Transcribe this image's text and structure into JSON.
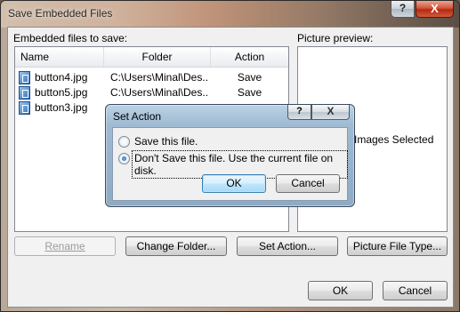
{
  "window": {
    "title": "Save Embedded Files",
    "close_glyph": "X",
    "help_glyph": "?"
  },
  "list": {
    "label": "Embedded files to save:",
    "columns": [
      "Name",
      "Folder",
      "Action"
    ],
    "rows": [
      {
        "name": "button4.jpg",
        "folder": "C:\\Users\\Minal\\Des...",
        "action": "Save"
      },
      {
        "name": "button5.jpg",
        "folder": "C:\\Users\\Minal\\Des...",
        "action": "Save"
      },
      {
        "name": "button3.jpg"
      }
    ]
  },
  "preview": {
    "label": "Picture preview:",
    "text": "Images Selected"
  },
  "buttons": {
    "rename": "Rename",
    "change_folder": "Change Folder...",
    "set_action": "Set Action...",
    "picture_file_type": "Picture File Type...",
    "ok": "OK",
    "cancel": "Cancel"
  },
  "modal": {
    "title": "Set Action",
    "help_glyph": "?",
    "close_glyph": "X",
    "option_save": "Save this file.",
    "option_dont_save": "Don't Save this file.  Use the current file on disk.",
    "selected": "dont_save",
    "ok": "OK",
    "cancel": "Cancel"
  },
  "icons": [
    "file-image-icon"
  ]
}
